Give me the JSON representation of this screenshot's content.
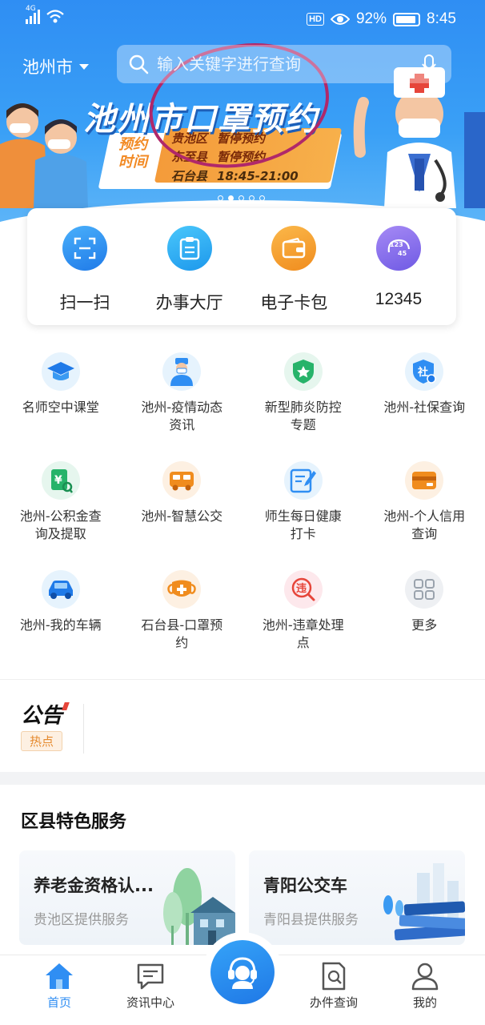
{
  "status_bar": {
    "network": "4G",
    "hd": "HD",
    "battery": "92%",
    "time": "8:45"
  },
  "header": {
    "city": "池州市",
    "search_placeholder": "输入关键字进行查询"
  },
  "banner": {
    "title": "池州市口罩预约",
    "time_label": "预约时间",
    "rows": [
      {
        "district": "贵池区",
        "status": "暂停预约"
      },
      {
        "district": "东至县",
        "status": "暂停预约"
      },
      {
        "district": "石台县",
        "status": "18:45-21:00"
      }
    ],
    "slides": 5,
    "active_slide": 2
  },
  "quick_actions": [
    {
      "label": "扫一扫",
      "icon": "scan-icon"
    },
    {
      "label": "办事大厅",
      "icon": "clipboard-icon"
    },
    {
      "label": "电子卡包",
      "icon": "wallet-icon"
    },
    {
      "label": "12345",
      "icon": "hotline-12345-icon"
    }
  ],
  "services": [
    {
      "label": "名师空中课堂",
      "icon": "graduation-cap-icon"
    },
    {
      "label": "池州-疫情动态资讯",
      "icon": "doctor-icon"
    },
    {
      "label": "新型肺炎防控专题",
      "icon": "shield-star-icon"
    },
    {
      "label": "池州-社保查询",
      "icon": "social-security-icon"
    },
    {
      "label": "池州-公积金查询及提取",
      "icon": "fund-search-icon"
    },
    {
      "label": "池州-智慧公交",
      "icon": "bus-icon"
    },
    {
      "label": "师生每日健康打卡",
      "icon": "edit-note-icon"
    },
    {
      "label": "池州-个人信用查询",
      "icon": "card-icon"
    },
    {
      "label": "池州-我的车辆",
      "icon": "car-icon"
    },
    {
      "label": "石台县-口罩预约",
      "icon": "mask-icon"
    },
    {
      "label": "池州-违章处理点",
      "icon": "violation-icon"
    },
    {
      "label": "更多",
      "icon": "more-grid-icon"
    }
  ],
  "announcement": {
    "title": "公告",
    "tag": "热点"
  },
  "district": {
    "title": "区县特色服务",
    "cards": [
      {
        "title": "养老金资格认...",
        "subtitle": "贵池区提供服务"
      },
      {
        "title": "青阳公交车",
        "subtitle": "青阳县提供服务"
      }
    ]
  },
  "bottom_nav": [
    {
      "label": "首页",
      "icon": "home-icon",
      "active": true
    },
    {
      "label": "资讯中心",
      "icon": "message-icon",
      "active": false
    },
    {
      "label": "",
      "icon": "customer-service-icon",
      "active": false
    },
    {
      "label": "办件查询",
      "icon": "document-search-icon",
      "active": false
    },
    {
      "label": "我的",
      "icon": "user-icon",
      "active": false
    }
  ],
  "colors": {
    "primary": "#2f8ef3",
    "accent_orange": "#f7a23b",
    "annotation_circle": "#b0286a"
  }
}
